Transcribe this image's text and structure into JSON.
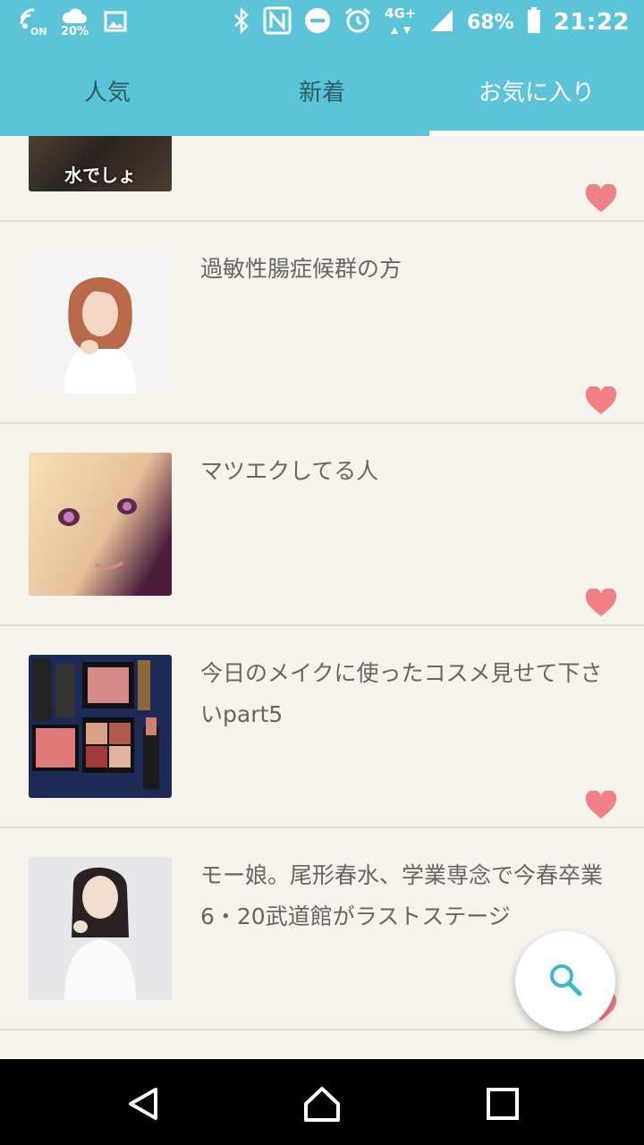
{
  "status_bar": {
    "nfc_on_label": "ON",
    "weather_percent": "20%",
    "network_label": "4G+",
    "battery_percent": "68%",
    "time": "21:22"
  },
  "tabs": [
    {
      "label": "人気",
      "active": false
    },
    {
      "label": "新着",
      "active": false
    },
    {
      "label": "お気に入り",
      "active": true
    }
  ],
  "items": [
    {
      "title": "",
      "thumb_caption": "水でしょ",
      "favorited": true
    },
    {
      "title": "過敏性腸症候群の方",
      "favorited": true
    },
    {
      "title": "マツエクしてる人",
      "favorited": true
    },
    {
      "title": "今日のメイクに使ったコスメ見せて下さいpart5",
      "favorited": true
    },
    {
      "title": "モー娘。尾形春水、学業専念で今春卒業 6・20武道館がラストステージ",
      "favorited": true
    }
  ],
  "fab": {
    "icon": "search-icon"
  },
  "nav": {
    "back": "back-icon",
    "home": "home-icon",
    "recents": "recents-icon"
  },
  "colors": {
    "header": "#5cc4d8",
    "heart": "#f07f86",
    "background": "#f7f4ee"
  }
}
